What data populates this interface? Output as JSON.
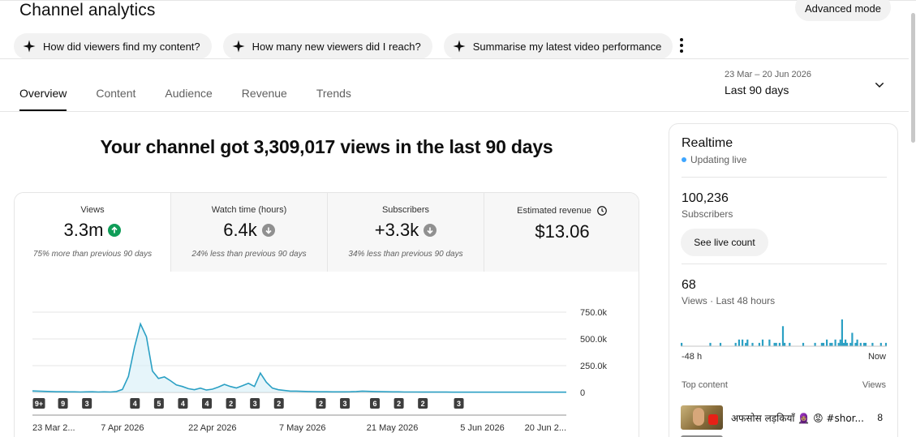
{
  "page": {
    "title": "Channel analytics",
    "advanced_mode_label": "Advanced mode"
  },
  "suggestions": [
    {
      "label": "How did viewers find my content?"
    },
    {
      "label": "How many new viewers did I reach?"
    },
    {
      "label": "Summarise my latest video performance"
    }
  ],
  "tabs": [
    {
      "label": "Overview",
      "active": true
    },
    {
      "label": "Content",
      "active": false
    },
    {
      "label": "Audience",
      "active": false
    },
    {
      "label": "Revenue",
      "active": false
    },
    {
      "label": "Trends",
      "active": false
    }
  ],
  "date_range": {
    "range": "23 Mar – 20 Jun 2026",
    "label": "Last 90 days"
  },
  "headline": "Your channel got 3,309,017 views in the last 90 days",
  "metrics": [
    {
      "label": "Views",
      "value": "3.3m",
      "trend": "up",
      "note": "75% more than previous 90 days"
    },
    {
      "label": "Watch time (hours)",
      "value": "6.4k",
      "trend": "down",
      "note": "24% less than previous 90 days"
    },
    {
      "label": "Subscribers",
      "value": "+3.3k",
      "trend": "down",
      "note": "34% less than previous 90 days"
    },
    {
      "label": "Estimated revenue",
      "value": "$13.06",
      "trend": "none",
      "note": ""
    }
  ],
  "chart_data": {
    "type": "area",
    "series": [
      {
        "name": "Views",
        "color": "#2ba0c4",
        "values": [
          14000,
          12000,
          10000,
          8000,
          6000,
          6000,
          5000,
          5000,
          4000,
          5000,
          6000,
          4000,
          5000,
          4000,
          8000,
          28000,
          150000,
          420000,
          640000,
          520000,
          200000,
          130000,
          145000,
          110000,
          70000,
          55000,
          35000,
          25000,
          40000,
          22000,
          30000,
          50000,
          75000,
          55000,
          42000,
          62000,
          85000,
          55000,
          180000,
          95000,
          40000,
          25000,
          18000,
          12000,
          12000,
          10000,
          8000,
          7000,
          6000,
          6000,
          5000,
          5000,
          5000,
          6000,
          8000,
          12000,
          10000,
          8000,
          7000,
          6000,
          5000,
          5000,
          4000,
          4000,
          3500,
          3000,
          3000,
          3000,
          3000,
          3000,
          2500,
          2500,
          2500,
          2500,
          2500,
          2500,
          2500,
          2500,
          2500,
          2500,
          2000,
          2000,
          2000,
          2000,
          2000,
          2000,
          2000,
          2000,
          2000,
          2000
        ]
      }
    ],
    "x_tick_labels": [
      "23 Mar 2...",
      "7 Apr 2026",
      "22 Apr 2026",
      "7 May 2026",
      "21 May 2026",
      "5 Jun 2026",
      "20 Jun 2..."
    ],
    "y_tick_labels": [
      "750.0k",
      "500.0k",
      "250.0k",
      "0"
    ],
    "ylim": [
      0,
      750000
    ],
    "grid": true,
    "markers": [
      {
        "day": 0,
        "label": "9+"
      },
      {
        "day": 4,
        "label": "9"
      },
      {
        "day": 8,
        "label": "3"
      },
      {
        "day": 16,
        "label": "4"
      },
      {
        "day": 20,
        "label": "5"
      },
      {
        "day": 24,
        "label": "4"
      },
      {
        "day": 28,
        "label": "4"
      },
      {
        "day": 32,
        "label": "2"
      },
      {
        "day": 36,
        "label": "3"
      },
      {
        "day": 40,
        "label": "2"
      },
      {
        "day": 47,
        "label": "2"
      },
      {
        "day": 51,
        "label": "3"
      },
      {
        "day": 56,
        "label": "6"
      },
      {
        "day": 60,
        "label": "2"
      },
      {
        "day": 64,
        "label": "2"
      },
      {
        "day": 70,
        "label": "3"
      }
    ]
  },
  "realtime": {
    "title": "Realtime",
    "status": "Updating live",
    "subscribers_value": "100,236",
    "subscribers_label": "Subscribers",
    "live_count_button": "See live count",
    "views_value": "68",
    "views_label": "Views · Last 48 hours",
    "axis_left": "-48 h",
    "axis_right": "Now",
    "bars": [
      1,
      0,
      0,
      0,
      0,
      0,
      0,
      0,
      0,
      0,
      0,
      0,
      0,
      0,
      0,
      0,
      0,
      1,
      0,
      0,
      0,
      0,
      0,
      1,
      0,
      0,
      0,
      0,
      0,
      0,
      0,
      0,
      1,
      0,
      2,
      0,
      2,
      0,
      1,
      2,
      0,
      0,
      1,
      0,
      0,
      0,
      1,
      0,
      2,
      0,
      0,
      0,
      2,
      0,
      0,
      1,
      1,
      0,
      1,
      0,
      6,
      1,
      0,
      0,
      1,
      0,
      0,
      0,
      0,
      0,
      0,
      0,
      1,
      0,
      0,
      0,
      0,
      0,
      0,
      1,
      0,
      0,
      0,
      1,
      1,
      0,
      2,
      0,
      1,
      1,
      0,
      2,
      0,
      1,
      2,
      8,
      1,
      2,
      1,
      0,
      1,
      4,
      0,
      1,
      2,
      0,
      1,
      0,
      1,
      1,
      0,
      0,
      0,
      1,
      0,
      0,
      0,
      0,
      1,
      0,
      0,
      1
    ],
    "top_content_label": "Top content",
    "views_column_label": "Views",
    "top_content": [
      {
        "title": "अफसोस लड़कियाँ 🧕🏽 😡 #shor...",
        "views": "8"
      }
    ]
  }
}
